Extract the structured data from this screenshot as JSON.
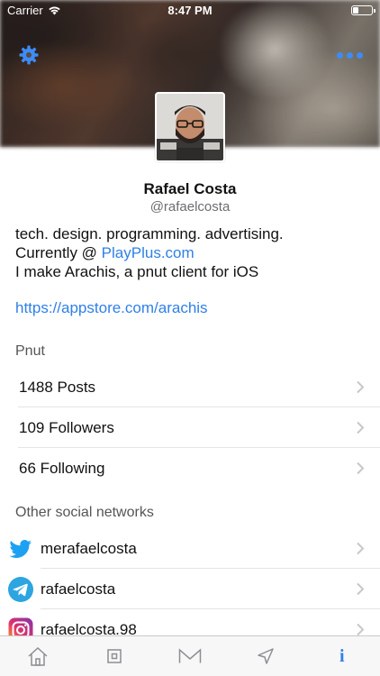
{
  "status_bar": {
    "carrier": "Carrier",
    "time": "8:47 PM",
    "battery_level": 0.3
  },
  "profile": {
    "name": "Rafael Costa",
    "handle": "@rafaelcosta",
    "bio_line1": "tech. design. programming. advertising.",
    "bio_line2_prefix": "Currently @ ",
    "bio_line2_link": "PlayPlus.com",
    "bio_line3": "I make Arachis, a pnut client for iOS",
    "url": "https://appstore.com/arachis"
  },
  "pnut": {
    "section_label": "Pnut",
    "rows": [
      {
        "label": "1488 Posts"
      },
      {
        "label": "109 Followers"
      },
      {
        "label": "66 Following"
      }
    ]
  },
  "social": {
    "section_label": "Other social networks",
    "rows": [
      {
        "network": "twitter-icon",
        "label": "merafaelcosta"
      },
      {
        "network": "telegram-icon",
        "label": "rafaelcosta"
      },
      {
        "network": "instagram-icon",
        "label": "rafaelcosta.98"
      }
    ]
  },
  "tabbar": {
    "tabs": [
      {
        "icon": "home-icon"
      },
      {
        "icon": "posts-icon"
      },
      {
        "icon": "mail-icon"
      },
      {
        "icon": "send-icon"
      },
      {
        "icon": "info-icon",
        "label": "i",
        "active": true
      }
    ]
  },
  "colors": {
    "accent": "#2f80e8",
    "twitter": "#1da1f2",
    "telegram": "#2ca5e0",
    "instagram": "#c13584"
  }
}
